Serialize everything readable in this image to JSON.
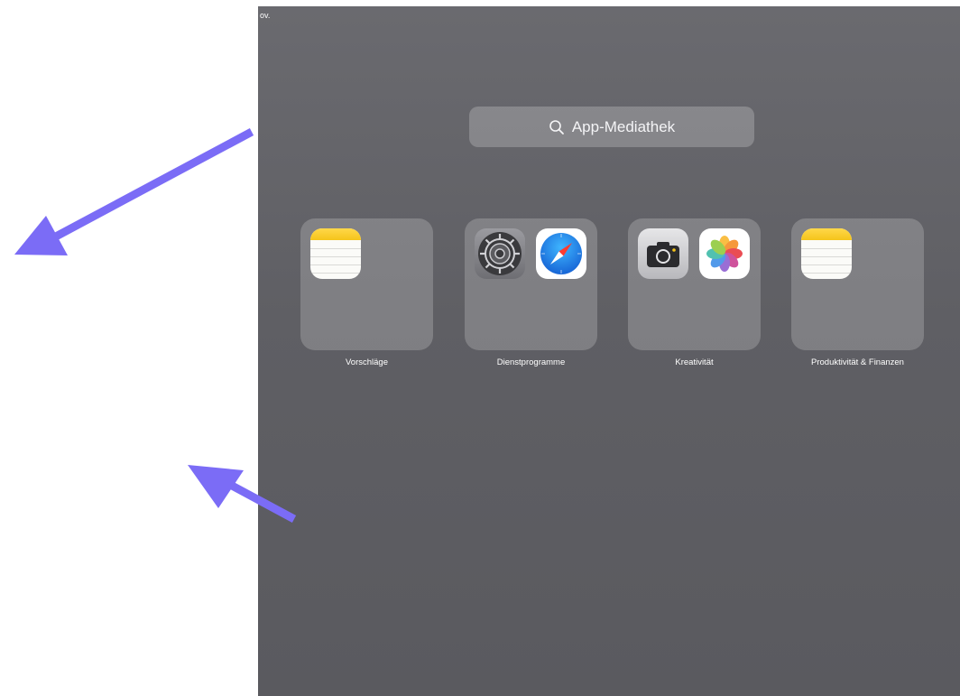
{
  "status_bar": {
    "partial_text": "ov."
  },
  "search": {
    "placeholder": "App-Mediathek",
    "icon": "search-icon"
  },
  "folders": [
    {
      "label": "Vorschläge",
      "apps": [
        "notes-icon"
      ]
    },
    {
      "label": "Dienstprogramme",
      "apps": [
        "settings-icon",
        "safari-icon"
      ]
    },
    {
      "label": "Kreativität",
      "apps": [
        "camera-icon",
        "photos-icon"
      ]
    },
    {
      "label": "Produktivität & Finanzen",
      "apps": [
        "notes-icon"
      ]
    }
  ],
  "annotations": {
    "arrow_color": "#7b6cf6",
    "arrows": [
      "arrow-pointing-left-down",
      "arrow-pointing-left-up"
    ]
  },
  "colors": {
    "screen_background": "#5f5f64",
    "notes_yellow": "#f5c41a",
    "safari_blue": "#1e88e5"
  }
}
